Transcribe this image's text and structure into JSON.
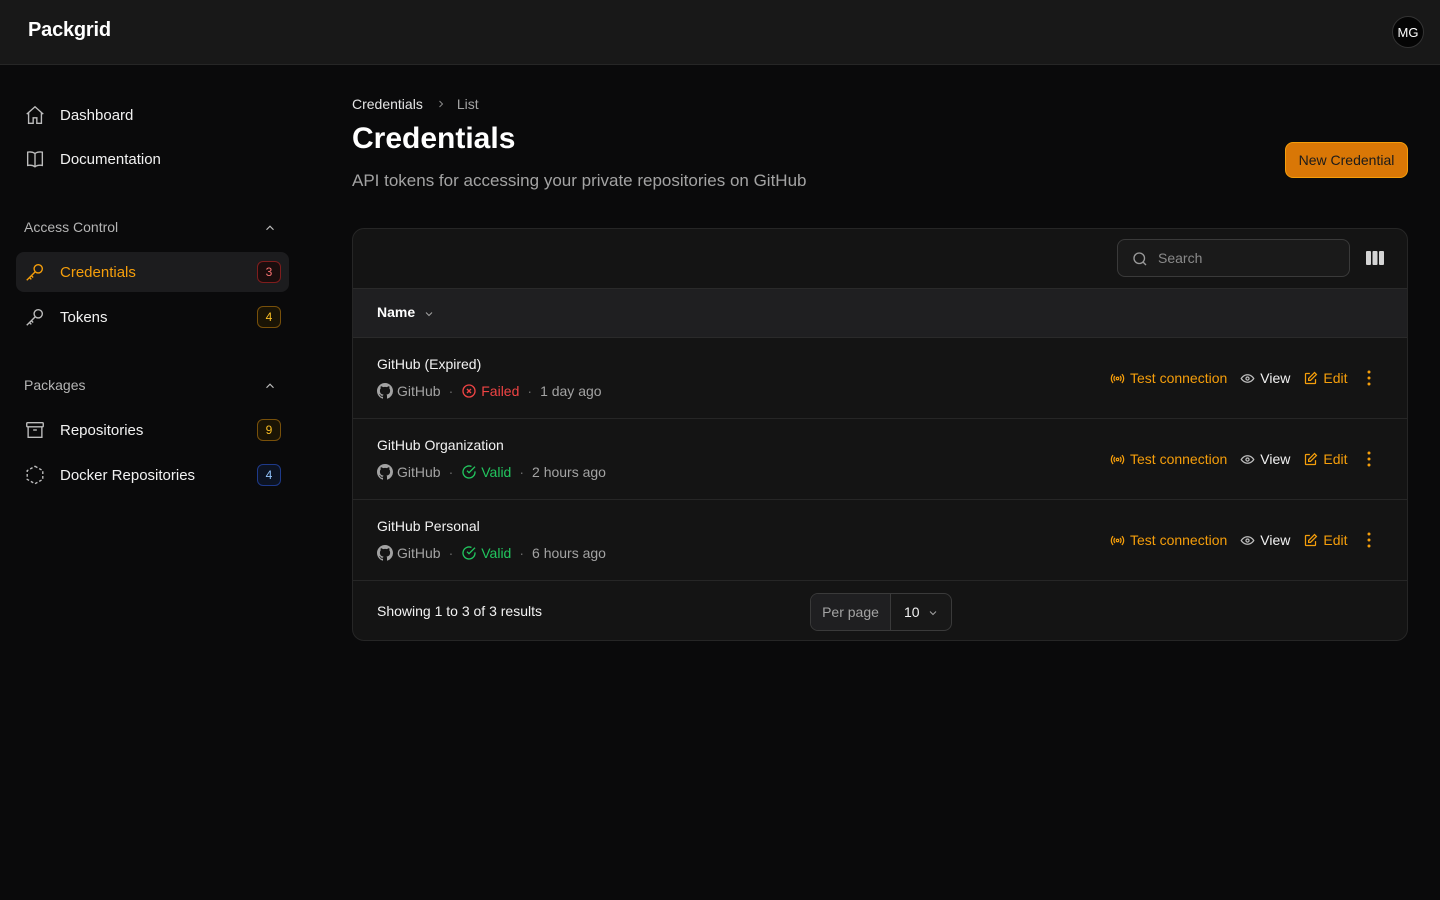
{
  "app": {
    "brand": "Packgrid",
    "avatar_initials": "MG",
    "accent_color": "#f59e0b"
  },
  "sidebar": {
    "top_items": [
      {
        "label": "Dashboard",
        "icon": "home-icon"
      },
      {
        "label": "Documentation",
        "icon": "book-icon"
      }
    ],
    "groups": [
      {
        "title": "Access Control",
        "items": [
          {
            "label": "Credentials",
            "icon": "key-icon",
            "count": "3",
            "active": true
          },
          {
            "label": "Tokens",
            "icon": "key-icon",
            "count": "4"
          }
        ]
      },
      {
        "title": "Packages",
        "items": [
          {
            "label": "Repositories",
            "icon": "archive-icon",
            "count": "9"
          },
          {
            "label": "Docker Repositories",
            "icon": "cube-icon",
            "count": "4"
          }
        ]
      }
    ]
  },
  "breadcrumb": {
    "parent": "Credentials",
    "current": "List"
  },
  "header": {
    "title": "Credentials",
    "subtitle": "API tokens for accessing your private repositories on GitHub",
    "new_button": "New Credential"
  },
  "table": {
    "search_placeholder": "Search",
    "column_name": "Name",
    "rows": [
      {
        "name": "GitHub (Expired)",
        "provider": "GitHub",
        "status": "Failed",
        "time": "1 day ago"
      },
      {
        "name": "GitHub Organization",
        "provider": "GitHub",
        "status": "Valid",
        "time": "2 hours ago"
      },
      {
        "name": "GitHub Personal",
        "provider": "GitHub",
        "status": "Valid",
        "time": "6 hours ago"
      }
    ],
    "actions": {
      "test": "Test connection",
      "view": "View",
      "edit": "Edit"
    },
    "footer": {
      "showing": "Showing 1 to 3 of 3 results",
      "per_page_label": "Per page",
      "per_page_value": "10"
    }
  }
}
